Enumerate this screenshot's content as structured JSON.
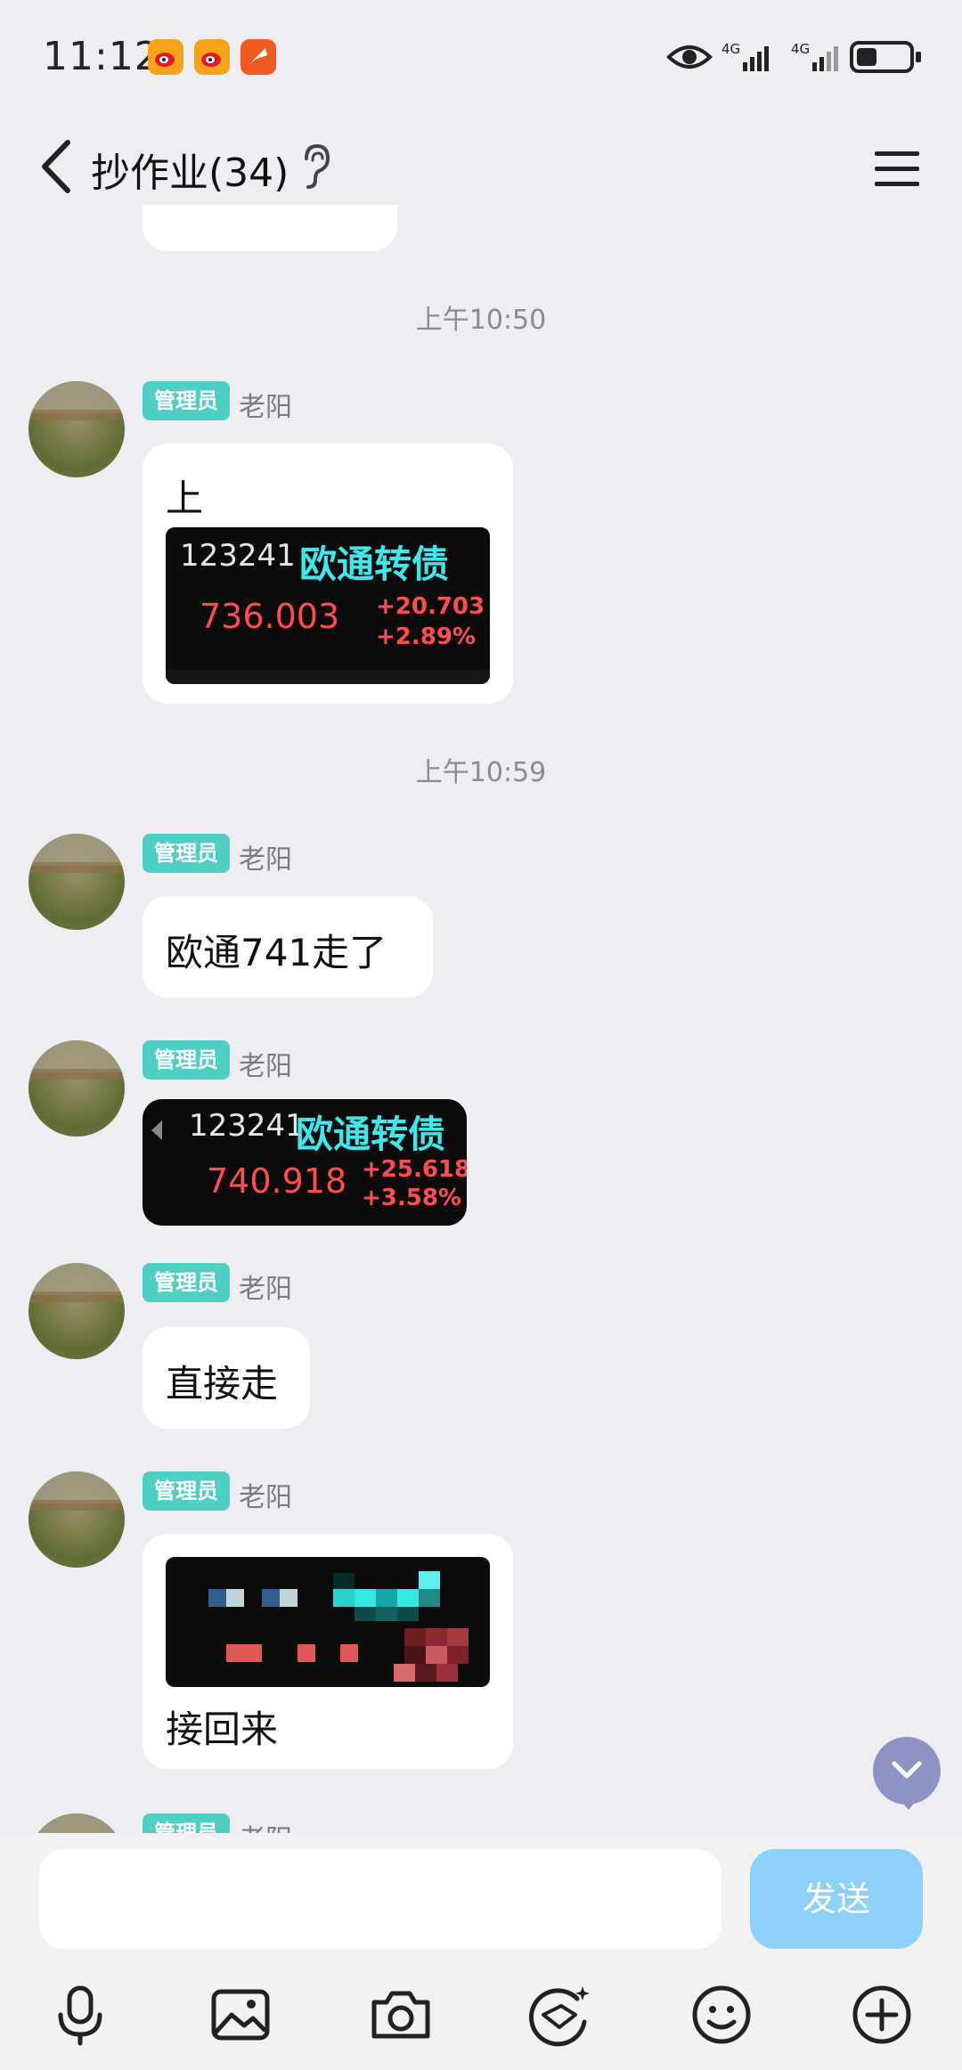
{
  "status_bar": {
    "time": "11:12",
    "network1": "4G",
    "network2": "4G"
  },
  "header": {
    "title": "抄作业(34)"
  },
  "timestamps": [
    "上午10:50",
    "上午10:59"
  ],
  "messages": [
    {
      "badge": "管理员",
      "sender": "老阳",
      "text": "上",
      "quote": {
        "code": "123241",
        "name": "欧通转债",
        "price": "736.003",
        "change": "+20.703",
        "change_pct": "+2.89%"
      }
    },
    {
      "badge": "管理员",
      "sender": "老阳",
      "text": "欧通741走了"
    },
    {
      "badge": "管理员",
      "sender": "老阳",
      "quote": {
        "code": "123241",
        "name": "欧通转债",
        "price": "740.918",
        "change": "+25.618",
        "change_pct": "+3.58%"
      }
    },
    {
      "badge": "管理员",
      "sender": "老阳",
      "text": "直接走"
    },
    {
      "badge": "管理员",
      "sender": "老阳",
      "text": "接回来",
      "image": "pixelated-screenshot"
    },
    {
      "badge": "管理员",
      "sender": "老阳"
    }
  ],
  "input": {
    "placeholder": "",
    "send_label": "发送"
  },
  "toolbar": [
    "mic-icon",
    "image-icon",
    "camera-icon",
    "sticker-icon",
    "emoji-icon",
    "plus-icon"
  ],
  "colors": {
    "admin_badge": "#4fcfc4",
    "send_button": "#8dd0f8",
    "quote_name": "#3ee8ea",
    "quote_up": "#ff4d4d"
  }
}
